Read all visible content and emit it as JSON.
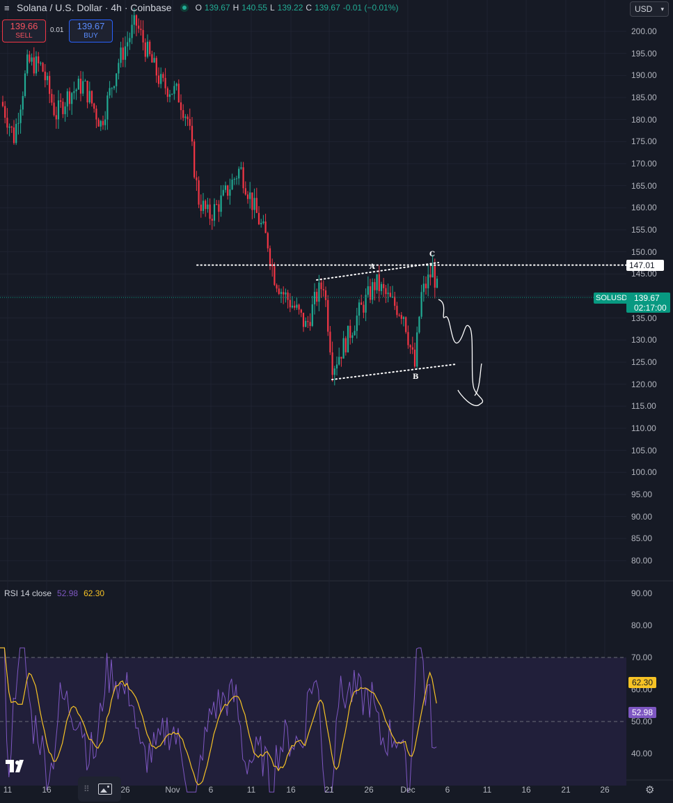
{
  "header": {
    "menu_icon": "hamburger-icon",
    "symbol_title": "Solana / U.S. Dollar · 4h · Coinbase",
    "ohlc": {
      "o_label": "O",
      "o_value": "139.67",
      "h_label": "H",
      "h_value": "140.55",
      "l_label": "L",
      "l_value": "139.22",
      "c_label": "C",
      "c_value": "139.67",
      "change": "-0.01 (−0.01%)"
    }
  },
  "trade": {
    "sell_price": "139.66",
    "sell_label": "SELL",
    "spread": "0.01",
    "buy_price": "139.67",
    "buy_label": "BUY"
  },
  "currency": {
    "value": "USD",
    "icon": "chevron-down-icon"
  },
  "price_axis": {
    "ticks": [
      "200.00",
      "195.00",
      "190.00",
      "185.00",
      "180.00",
      "175.00",
      "170.00",
      "165.00",
      "160.00",
      "155.00",
      "150.00",
      "145.00",
      "140.00",
      "135.00",
      "130.00",
      "125.00",
      "120.00",
      "115.00",
      "110.00",
      "105.00",
      "100.00",
      "95.00",
      "90.00",
      "85.00",
      "80.00"
    ],
    "level_line_value": "147.01",
    "symbol_tag": "SOLUSD",
    "current_price": "139.67",
    "countdown": "02:17:00"
  },
  "annotations": {
    "A": "A",
    "B": "B",
    "C": "C"
  },
  "rsi": {
    "name": "RSI 14 close",
    "rsi_value": "52.98",
    "ma_value": "62.30",
    "ticks": [
      "90.00",
      "80.00",
      "70.00",
      "60.00",
      "50.00",
      "40.00"
    ],
    "colors": {
      "rsi": "#7e57c2",
      "ma": "#f7c325"
    }
  },
  "time_axis": {
    "labels": [
      "11",
      "16",
      "26",
      "Nov",
      "6",
      "11",
      "16",
      "21",
      "26",
      "Dec",
      "6",
      "11",
      "16",
      "21",
      "26"
    ]
  },
  "toolbar": {
    "settings_icon": "gear-icon",
    "grip_icon": "grip-icon",
    "snapshot_icon": "image-icon",
    "logo": "tradingview-logo"
  },
  "colors": {
    "up": "#22ab94",
    "down": "#f23645",
    "background": "#161a25",
    "level_line": "#ffffff"
  }
}
